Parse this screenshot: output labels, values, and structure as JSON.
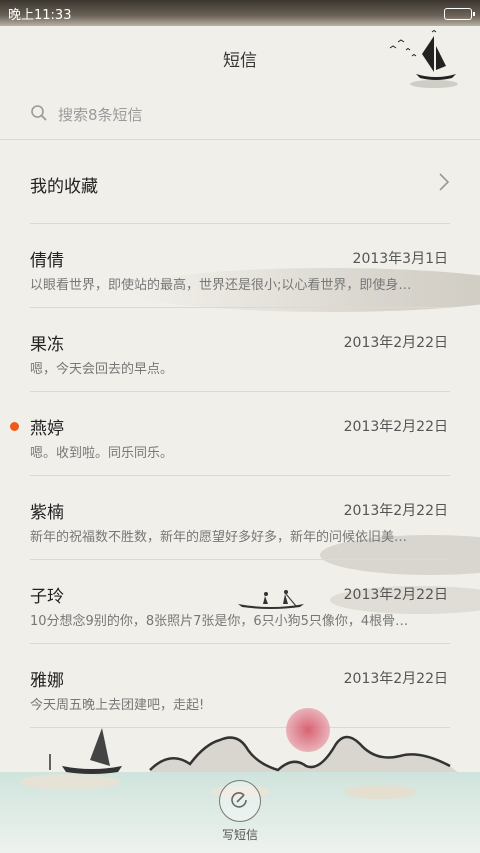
{
  "status_bar": {
    "time": "晚上11:33"
  },
  "header": {
    "title": "短信"
  },
  "search": {
    "placeholder": "搜索8条短信"
  },
  "favorites": {
    "label": "我的收藏"
  },
  "conversations": [
    {
      "name": "倩倩",
      "date": "2013年3月1日",
      "preview": "以眼看世界，即使站的最高，世界还是很小;以心看世界，即使身…",
      "unread": false
    },
    {
      "name": "果冻",
      "date": "2013年2月22日",
      "preview": "嗯，今天会回去的早点。",
      "unread": false
    },
    {
      "name": "燕婷",
      "date": "2013年2月22日",
      "preview": "嗯。收到啦。同乐同乐。",
      "unread": true
    },
    {
      "name": "紫楠",
      "date": "2013年2月22日",
      "preview": "新年的祝福数不胜数，新年的愿望好多好多，新年的问候依旧美…",
      "unread": false
    },
    {
      "name": "子玲",
      "date": "2013年2月22日",
      "preview": "10分想念9别的你，8张照片7张是你，6只小狗5只像你，4根骨…",
      "unread": false
    },
    {
      "name": "雅娜",
      "date": "2013年2月22日",
      "preview": "今天周五晚上去团建吧，走起!",
      "unread": false
    }
  ],
  "compose": {
    "label": "写短信",
    "icon": "compose-icon"
  },
  "colors": {
    "unread_dot": "#f0581c",
    "background": "#f1efe9"
  }
}
